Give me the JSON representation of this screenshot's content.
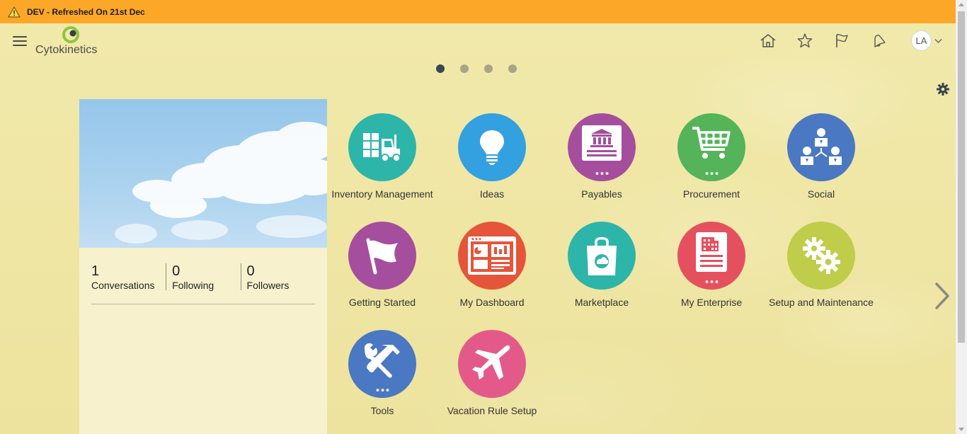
{
  "banner": {
    "text": "DEV - Refreshed On 21st Dec",
    "icon": "warning-icon"
  },
  "header": {
    "logo_text": "Cytokinetics",
    "avatar_initials": "LA",
    "icons": [
      "home-icon",
      "star-icon",
      "flag-icon",
      "bell-icon"
    ]
  },
  "carousel": {
    "pages": 4,
    "active_page": 1
  },
  "profile": {
    "stats": [
      {
        "value": "1",
        "label": "Conversations"
      },
      {
        "value": "0",
        "label": "Following"
      },
      {
        "value": "0",
        "label": "Followers"
      }
    ]
  },
  "apps": [
    {
      "label": "Inventory Management",
      "icon": "forklift-icon",
      "color": "#2eb5a9"
    },
    {
      "label": "Ideas",
      "icon": "lightbulb-icon",
      "color": "#33a0e0"
    },
    {
      "label": "Payables",
      "icon": "bank-icon",
      "color": "#a54e9e"
    },
    {
      "label": "Procurement",
      "icon": "cart-icon",
      "color": "#55b35a"
    },
    {
      "label": "Social",
      "icon": "people-icon",
      "color": "#4a78c2"
    },
    {
      "label": "Getting Started",
      "icon": "flag-icon",
      "color": "#a54e9e"
    },
    {
      "label": "My Dashboard",
      "icon": "dashboard-icon",
      "color": "#e5553a"
    },
    {
      "label": "Marketplace",
      "icon": "shopping-bag-icon",
      "color": "#2eb5a9"
    },
    {
      "label": "My Enterprise",
      "icon": "building-icon",
      "color": "#e5505f"
    },
    {
      "label": "Setup and Maintenance",
      "icon": "gears-icon",
      "color": "#bfcd4a"
    },
    {
      "label": "Tools",
      "icon": "tools-icon",
      "color": "#4a78c2"
    },
    {
      "label": "Vacation Rule Setup",
      "icon": "airplane-icon",
      "color": "#e35a8a"
    }
  ]
}
